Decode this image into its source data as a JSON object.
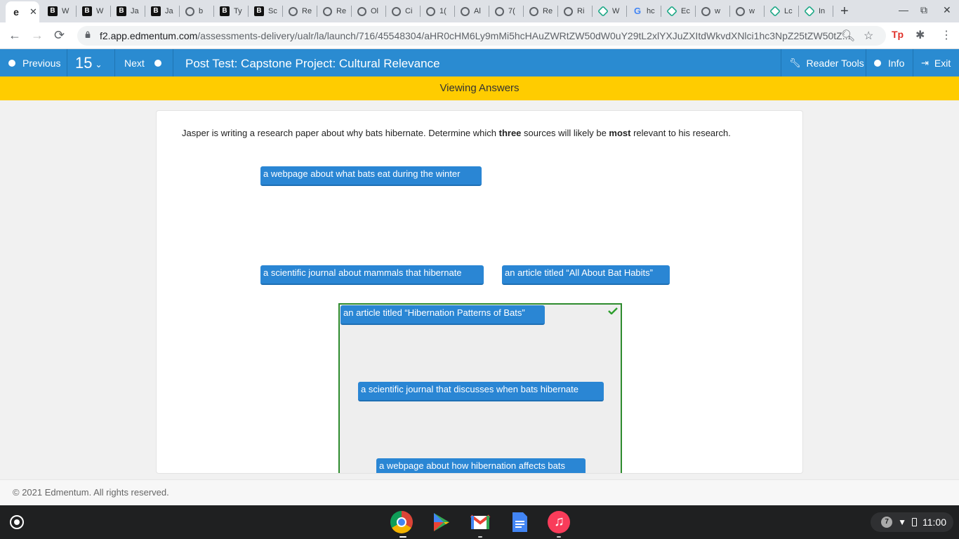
{
  "browser": {
    "tabs": [
      {
        "icon": "edmentum-e",
        "label": "",
        "active": true
      },
      {
        "icon": "brainly-b",
        "label": "W"
      },
      {
        "icon": "brainly-b",
        "label": "W"
      },
      {
        "icon": "brainly-b",
        "label": "Ja"
      },
      {
        "icon": "brainly-b",
        "label": "Ja"
      },
      {
        "icon": "globe",
        "label": "b"
      },
      {
        "icon": "brainly-b",
        "label": "Ty"
      },
      {
        "icon": "brainly-b",
        "label": "Sc"
      },
      {
        "icon": "globe",
        "label": "Re"
      },
      {
        "icon": "globe",
        "label": "Re"
      },
      {
        "icon": "globe",
        "label": "Ol"
      },
      {
        "icon": "globe",
        "label": "Ci"
      },
      {
        "icon": "globe",
        "label": "1("
      },
      {
        "icon": "globe",
        "label": "Al"
      },
      {
        "icon": "globe",
        "label": "7("
      },
      {
        "icon": "globe",
        "label": "Re"
      },
      {
        "icon": "globe",
        "label": "Ri"
      },
      {
        "icon": "edmentum",
        "label": "W"
      },
      {
        "icon": "google-g",
        "label": "hc"
      },
      {
        "icon": "edmentum",
        "label": "Ec"
      },
      {
        "icon": "globe",
        "label": "w"
      },
      {
        "icon": "globe",
        "label": "w"
      },
      {
        "icon": "edmentum",
        "label": "Lc"
      },
      {
        "icon": "edmentum",
        "label": "In"
      }
    ],
    "url_host": "f2.app.edmentum.com",
    "url_path": "/assessments-delivery/ualr/la/launch/716/45548304/aHR0cHM6Ly9mMi5hcHAuZWRtZW50dW0uY29tL2xlYXJuZXItdWkvdXNlci1hc3NpZ25tZW50tZ..."
  },
  "header": {
    "previous_label": "Previous",
    "question_number": "15",
    "next_label": "Next",
    "title": "Post Test: Capstone Project: Cultural Relevance",
    "reader_tools_label": "Reader Tools",
    "info_label": "Info",
    "exit_label": "Exit"
  },
  "banner": "Viewing Answers",
  "question": {
    "prompt_start": "Jasper is writing a research paper about why bats hibernate. Determine which ",
    "prompt_bold1": "three",
    "prompt_mid": " sources will likely be ",
    "prompt_bold2": "most",
    "prompt_end": " relevant to his research.",
    "source_chips": [
      "a webpage about what bats eat during the winter",
      "a scientific journal about mammals that hibernate",
      "an article titled “All About Bat Habits”"
    ],
    "answer_chips": [
      "an article titled “Hibernation Patterns of Bats”",
      "a scientific journal that discusses when bats hibernate",
      "a webpage about how hibernation affects bats"
    ]
  },
  "footer": "© 2021 Edmentum. All rights reserved.",
  "shelf": {
    "notification_count": "7",
    "time": "11:00"
  },
  "colors": {
    "header_blue": "#2a8bd1",
    "banner_yellow": "#ffcc00",
    "chip_blue": "#2a86d4",
    "correct_green": "#2e8b2e"
  }
}
